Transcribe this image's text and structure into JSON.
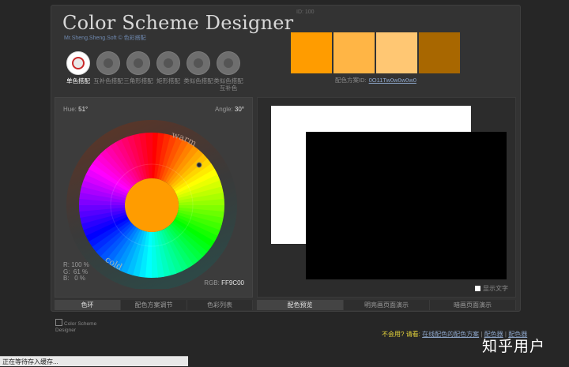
{
  "app": {
    "title": "Color Scheme Designer",
    "subtitle": "Mr.Sheng.Sheng.Soft © 色彩搭配",
    "top_id": "ID: 100"
  },
  "modes": [
    {
      "label": "单色搭配",
      "active": true,
      "icon": "mono-wheel-icon"
    },
    {
      "label": "互补色搭配",
      "active": false,
      "icon": "complement-wheel-icon"
    },
    {
      "label": "三角形搭配",
      "active": false,
      "icon": "triad-wheel-icon"
    },
    {
      "label": "矩形搭配",
      "active": false,
      "icon": "tetrad-wheel-icon"
    },
    {
      "label": "类似色搭配",
      "active": false,
      "icon": "analogic-wheel-icon"
    },
    {
      "label": "类似色搭配互补色",
      "active": false,
      "icon": "accented-analogic-wheel-icon"
    }
  ],
  "swatches": [
    "#FF9C00",
    "#FFB545",
    "#FFC773",
    "#A86700"
  ],
  "scheme": {
    "label": "配色方案ID:",
    "id": "0O11Tw0w0w0w0"
  },
  "wheel": {
    "hue_label": "Hue:",
    "hue_value": "51°",
    "angle_label": "Angle:",
    "angle_value": "30°",
    "warm_label": "warm",
    "cold_label": "cold",
    "center_color": "#FF9C00",
    "rgb": [
      {
        "k": "R:",
        "v": "100 %"
      },
      {
        "k": "G:",
        "v": "61 %"
      },
      {
        "k": "B:",
        "v": "0 %"
      }
    ],
    "rgb_hex_label": "RGB:",
    "rgb_hex_value": "FF9C00"
  },
  "preview": {
    "show_text_label": "显示文字"
  },
  "left_tabs": [
    "色环",
    "配色方案调节",
    "色彩列表"
  ],
  "right_tabs": [
    "配色预览",
    "明亮画页面演示",
    "暗画页面演示"
  ],
  "footer": {
    "broken_image_text": "Color Scheme Designer",
    "help_question": "不会用?",
    "help_prompt": "请看:",
    "help_link1": "在线配色的配色方案",
    "help_link2": "配色器",
    "help_link3": "配色器"
  },
  "watermark": "知乎用户",
  "status": "正在等待存入缓存..."
}
